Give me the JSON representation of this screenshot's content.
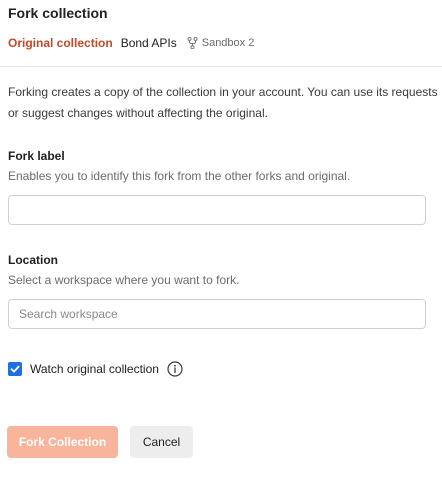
{
  "dialog": {
    "title": "Fork collection",
    "meta": {
      "original_label": "Original collection",
      "collection_name": "Bond APIs",
      "fork_name": "Sandbox 2",
      "fork_icon": "fork-icon"
    },
    "description": "Forking creates a copy of the collection in your account. You can use its requests or suggest changes without affecting the original."
  },
  "fork_label": {
    "label": "Fork label",
    "hint": "Enables you to identify this fork from the other forks and original.",
    "value": "",
    "placeholder": ""
  },
  "location": {
    "label": "Location",
    "hint": "Select a workspace where you want to fork.",
    "value": "",
    "placeholder": "Search workspace"
  },
  "watch": {
    "label": "Watch original collection",
    "checked": true,
    "info_icon": "info-icon"
  },
  "actions": {
    "fork_label": "Fork Collection",
    "cancel_label": "Cancel"
  },
  "colors": {
    "accent": "#c4492a",
    "primary_button_disabled": "#f9b49c",
    "checkbox": "#1f6fe0"
  }
}
